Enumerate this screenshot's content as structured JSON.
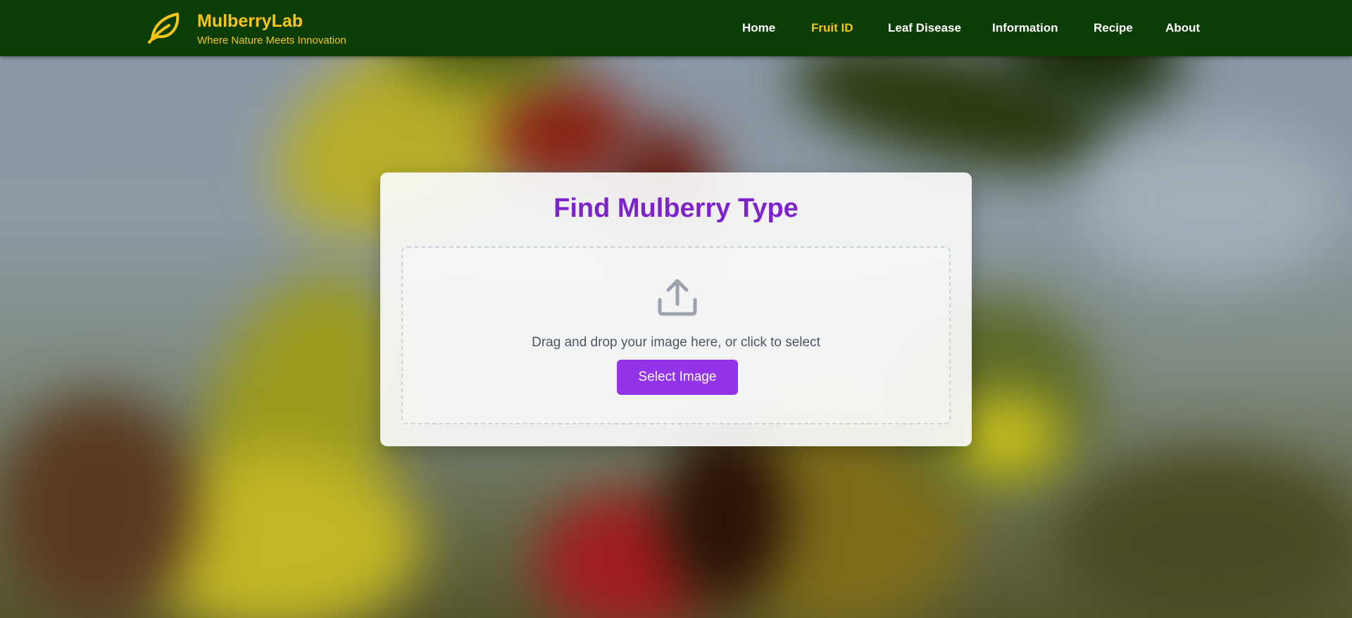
{
  "header": {
    "brand_name": "MulberryLab",
    "tagline": "Where Nature Meets Innovation",
    "logo_icon": "leaf-icon",
    "nav": [
      {
        "label": "Home",
        "active": false
      },
      {
        "label": "Fruit ID",
        "active": true
      },
      {
        "label": "Leaf Disease",
        "active": false
      },
      {
        "label": "Information",
        "active": false
      },
      {
        "label": "Recipe",
        "active": false
      },
      {
        "label": "About",
        "active": false
      }
    ]
  },
  "main": {
    "title": "Find Mulberry Type",
    "dropzone": {
      "icon": "upload-icon",
      "instruction": "Drag and drop your image here, or click to select",
      "button_label": "Select Image"
    }
  },
  "colors": {
    "header_bg": "#0b3d07",
    "brand_accent": "#f5c518",
    "title_purple": "#7e22ce",
    "button_purple": "#9333ea"
  }
}
